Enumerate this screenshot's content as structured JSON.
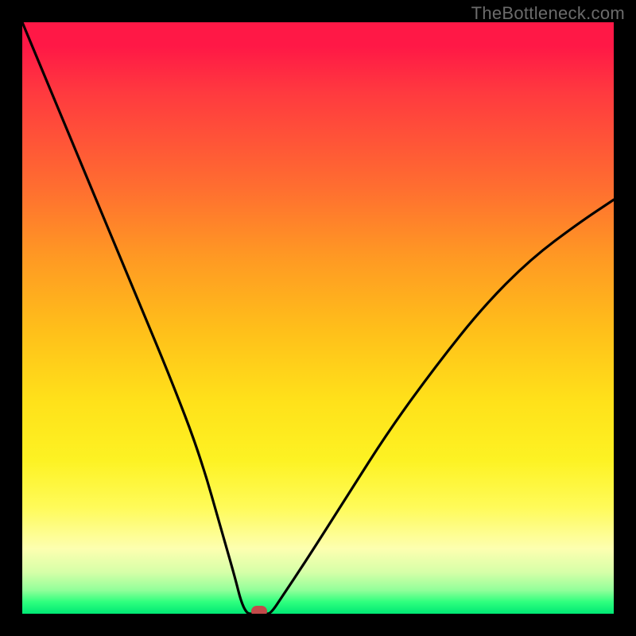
{
  "watermark": "TheBottleneck.com",
  "chart_data": {
    "type": "line",
    "title": "",
    "xlabel": "",
    "ylabel": "",
    "x_range": [
      0,
      100
    ],
    "y_range": [
      0,
      100
    ],
    "series": [
      {
        "name": "bottleneck-curve",
        "x": [
          0,
          5,
          10,
          15,
          20,
          25,
          30,
          34,
          36,
          37,
          38,
          39,
          40,
          41,
          42,
          44,
          48,
          55,
          62,
          70,
          78,
          86,
          94,
          100
        ],
        "y": [
          100,
          88,
          76,
          64,
          52,
          40,
          27,
          13,
          6,
          2,
          0,
          0,
          0,
          0,
          0,
          3,
          9,
          20,
          31,
          42,
          52,
          60,
          66,
          70
        ]
      }
    ],
    "marker": {
      "x": 40,
      "y": 0,
      "name": "optimal-point",
      "color": "#c24a4a"
    },
    "gradient_stops": [
      {
        "pct": 0,
        "color": "#ff1846"
      },
      {
        "pct": 28,
        "color": "#ff6e30"
      },
      {
        "pct": 52,
        "color": "#ffbf1a"
      },
      {
        "pct": 82,
        "color": "#fffb59"
      },
      {
        "pct": 96,
        "color": "#92ff9a"
      },
      {
        "pct": 100,
        "color": "#00e874"
      }
    ]
  }
}
